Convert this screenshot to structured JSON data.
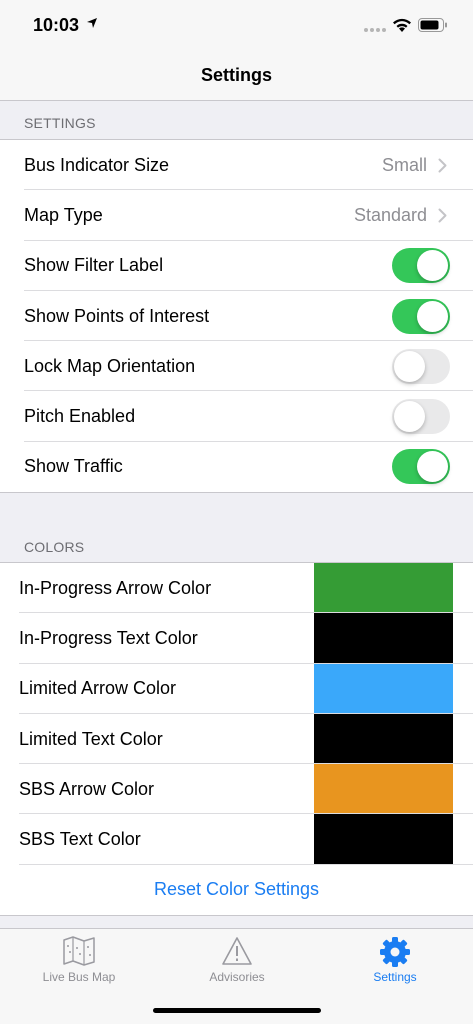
{
  "status": {
    "time": "10:03"
  },
  "nav": {
    "title": "Settings"
  },
  "settings_section": {
    "header": "SETTINGS",
    "rows": [
      {
        "label": "Bus Indicator Size",
        "value": "Small",
        "type": "disclosure"
      },
      {
        "label": "Map Type",
        "value": "Standard",
        "type": "disclosure"
      },
      {
        "label": "Show Filter Label",
        "on": true,
        "type": "toggle"
      },
      {
        "label": "Show Points of Interest",
        "on": true,
        "type": "toggle"
      },
      {
        "label": "Lock Map Orientation",
        "on": false,
        "type": "toggle"
      },
      {
        "label": "Pitch Enabled",
        "on": false,
        "type": "toggle"
      },
      {
        "label": "Show Traffic",
        "on": true,
        "type": "toggle"
      }
    ]
  },
  "colors_section": {
    "header": "COLORS",
    "rows": [
      {
        "label": "In-Progress Arrow Color",
        "color": "#359c35"
      },
      {
        "label": "In-Progress Text Color",
        "color": "#000000"
      },
      {
        "label": "Limited Arrow Color",
        "color": "#3aa8fa"
      },
      {
        "label": "Limited Text Color",
        "color": "#000000"
      },
      {
        "label": "SBS Arrow Color",
        "color": "#e8951f"
      },
      {
        "label": "SBS Text Color",
        "color": "#000000"
      }
    ],
    "reset_label": "Reset Color Settings"
  },
  "tabs": [
    {
      "label": "Live Bus Map",
      "icon": "map-icon",
      "active": false
    },
    {
      "label": "Advisories",
      "icon": "warning-icon",
      "active": false
    },
    {
      "label": "Settings",
      "icon": "gear-icon",
      "active": true
    }
  ],
  "colors": {
    "accent": "#1a7df2",
    "toggle_on": "#34c759"
  }
}
